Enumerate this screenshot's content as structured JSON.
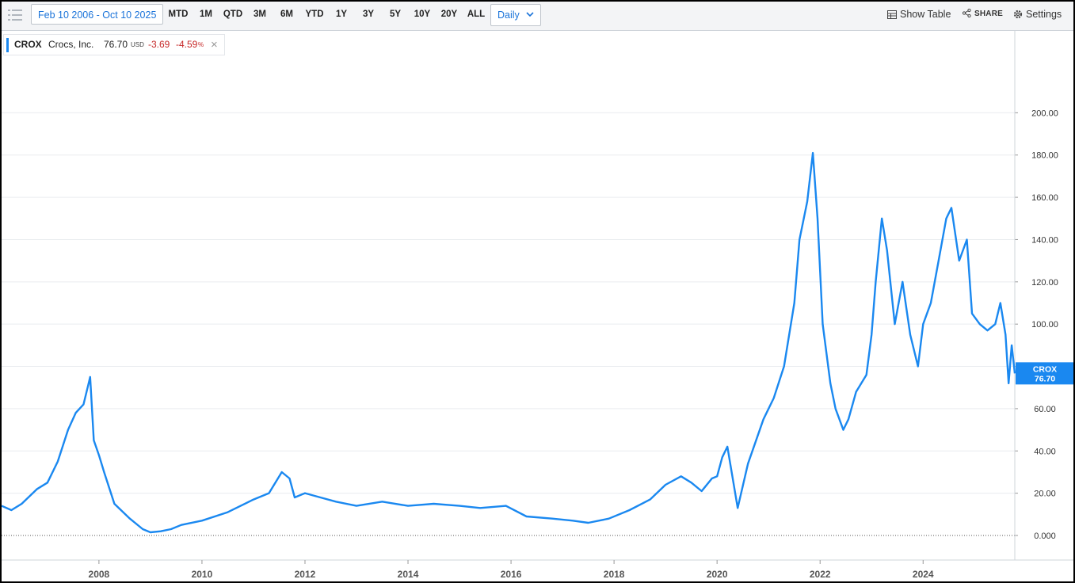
{
  "toolbar": {
    "range_label": "Feb 10 2006 - Oct 10 2025",
    "periods": [
      "MTD",
      "1M",
      "QTD",
      "3M",
      "6M",
      "YTD",
      "1Y",
      "3Y",
      "5Y",
      "10Y",
      "20Y",
      "ALL"
    ],
    "interval": "Daily",
    "show_table": "Show Table",
    "share": "SHARE",
    "settings": "Settings"
  },
  "legend": {
    "symbol": "CROX",
    "name": "Crocs, Inc.",
    "price": "76.70",
    "currency": "USD",
    "change": "-3.69",
    "change_pct": "-4.59",
    "pct_sign": "%"
  },
  "colors": {
    "line": "#1a88f0",
    "negative": "#c62828",
    "accent": "#1a73d9"
  },
  "chart_data": {
    "type": "line",
    "title": "",
    "xlabel": "",
    "ylabel": "",
    "ylim": [
      0,
      220
    ],
    "xlim": [
      2006.11,
      2025.78
    ],
    "y_ticks": [
      "0.000",
      "20.00",
      "40.00",
      "60.00",
      "80.00",
      "100.00",
      "120.00",
      "140.00",
      "160.00",
      "180.00",
      "200.00"
    ],
    "x_ticks": [
      "2008",
      "2010",
      "2012",
      "2014",
      "2016",
      "2018",
      "2020",
      "2022",
      "2024"
    ],
    "last_label": {
      "symbol": "CROX",
      "value": "76.70"
    },
    "grid": true,
    "series": [
      {
        "x": [
          2006.11,
          2006.3,
          2006.5,
          2006.8,
          2007.0,
          2007.2,
          2007.4,
          2007.55,
          2007.7,
          2007.8,
          2007.83,
          2007.9,
          2008.0,
          2008.1,
          2008.3,
          2008.6,
          2008.85,
          2009.0,
          2009.2,
          2009.4,
          2009.6,
          2010.0,
          2010.5,
          2011.0,
          2011.3,
          2011.55,
          2011.7,
          2011.8,
          2012.0,
          2012.3,
          2012.6,
          2013.0,
          2013.5,
          2014.0,
          2014.5,
          2015.0,
          2015.4,
          2015.9,
          2016.3,
          2016.8,
          2017.2,
          2017.5,
          2017.9,
          2018.3,
          2018.7,
          2019.0,
          2019.3,
          2019.5,
          2019.7,
          2019.9,
          2020.0,
          2020.1,
          2020.2,
          2020.4,
          2020.6,
          2020.9,
          2021.1,
          2021.3,
          2021.5,
          2021.6,
          2021.75,
          2021.86,
          2021.95,
          2022.05,
          2022.2,
          2022.3,
          2022.45,
          2022.55,
          2022.7,
          2022.9,
          2023.0,
          2023.08,
          2023.2,
          2023.3,
          2023.45,
          2023.6,
          2023.75,
          2023.9,
          2024.0,
          2024.15,
          2024.3,
          2024.45,
          2024.55,
          2024.7,
          2024.85,
          2024.95,
          2025.1,
          2025.25,
          2025.4,
          2025.5,
          2025.6,
          2025.66,
          2025.72,
          2025.78
        ],
        "y": [
          14,
          12,
          15,
          22,
          25,
          35,
          50,
          58,
          62,
          72,
          75,
          45,
          38,
          30,
          15,
          8,
          3,
          1.5,
          2,
          3,
          5,
          7,
          11,
          17,
          20,
          30,
          27,
          18,
          20,
          18,
          16,
          14,
          16,
          14,
          15,
          14,
          13,
          14,
          9,
          8,
          7,
          6,
          8,
          12,
          17,
          24,
          28,
          25,
          21,
          27,
          28,
          37,
          42,
          13,
          34,
          55,
          65,
          80,
          110,
          140,
          158,
          181,
          150,
          100,
          72,
          60,
          50,
          55,
          68,
          76,
          95,
          120,
          150,
          135,
          100,
          120,
          95,
          80,
          100,
          110,
          130,
          150,
          155,
          130,
          140,
          105,
          100,
          97,
          100,
          110,
          95,
          72,
          90,
          76.7
        ]
      }
    ]
  }
}
